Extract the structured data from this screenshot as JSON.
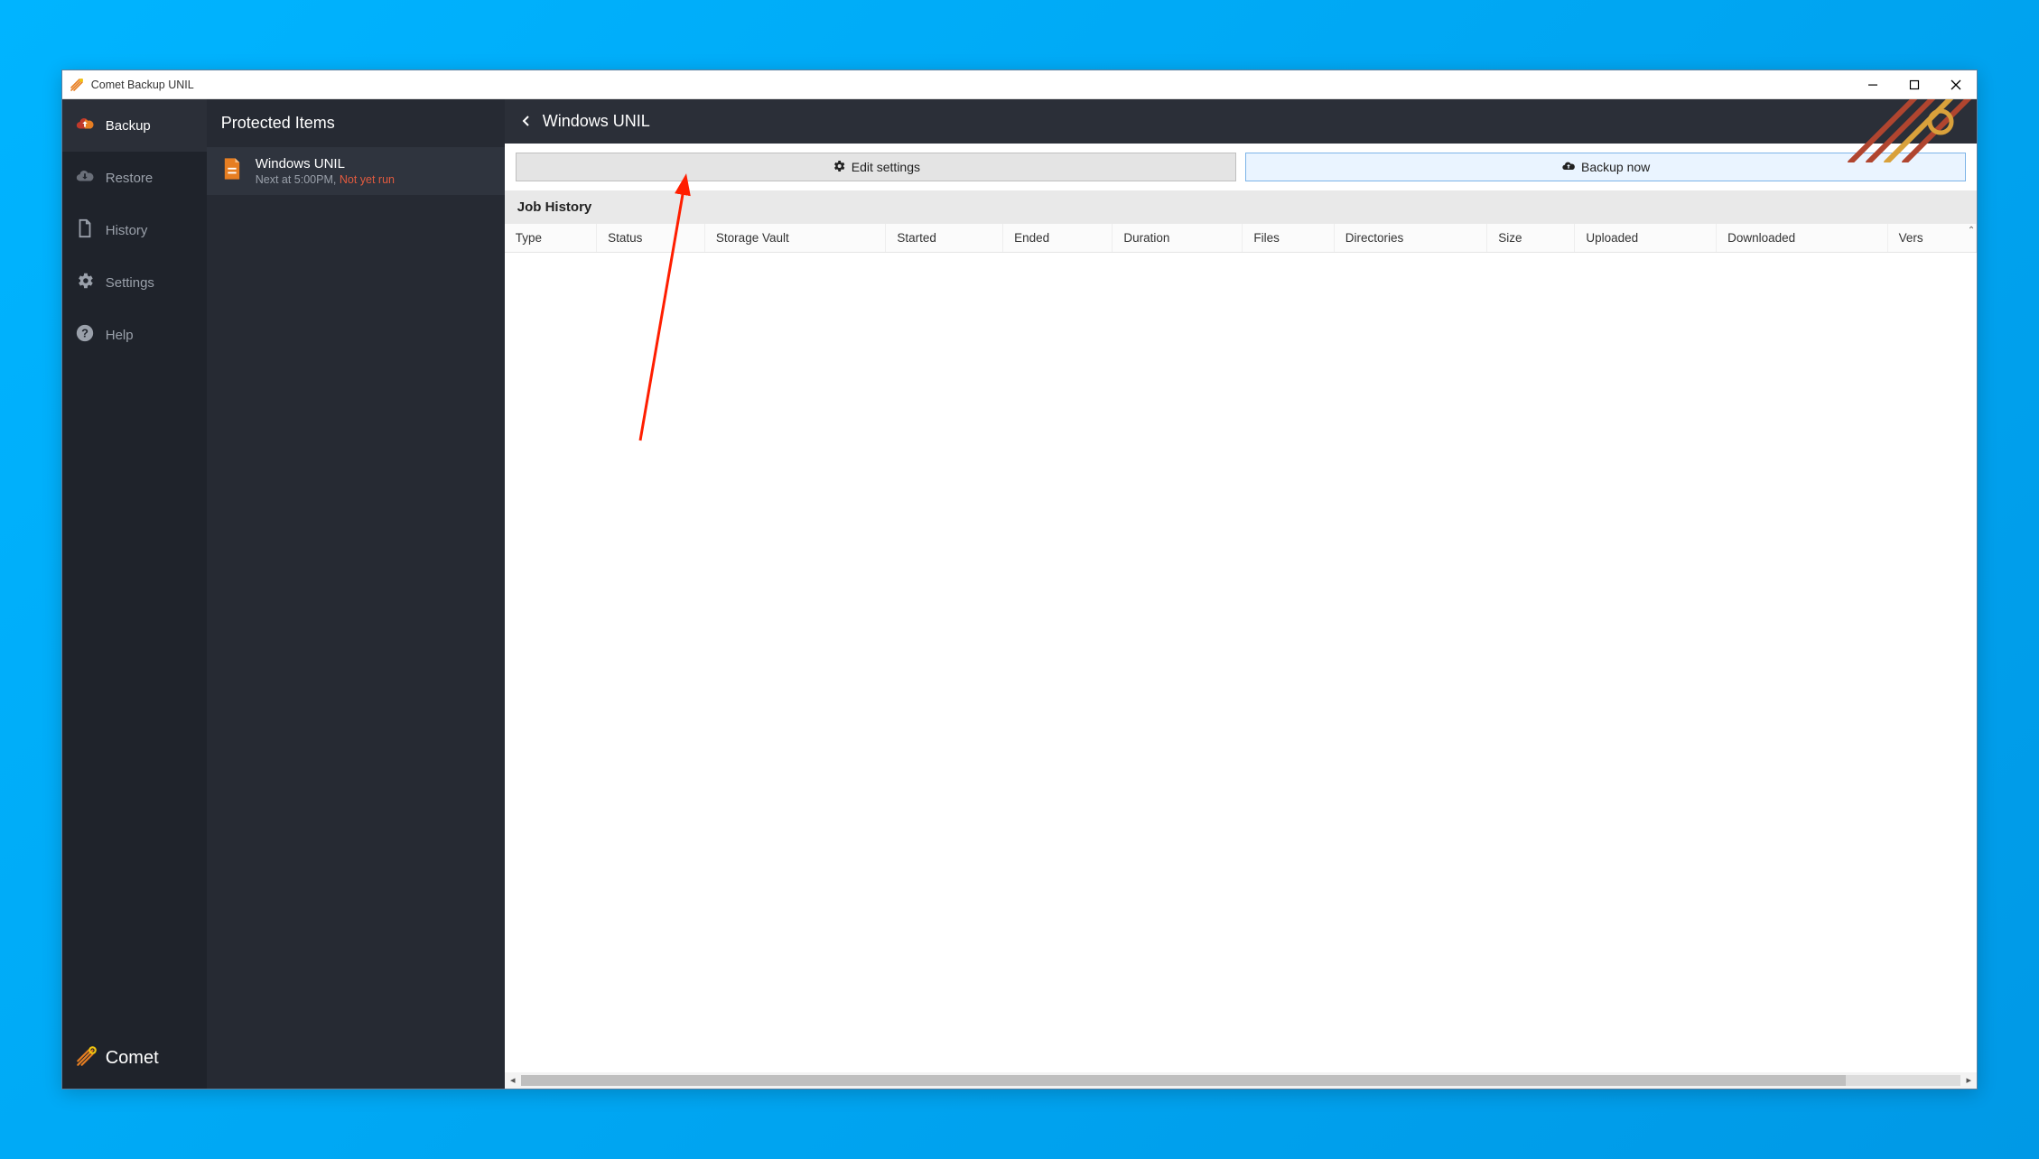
{
  "window": {
    "title": "Comet Backup UNIL"
  },
  "sidebar": {
    "items": [
      {
        "label": "Backup"
      },
      {
        "label": "Restore"
      },
      {
        "label": "History"
      },
      {
        "label": "Settings"
      },
      {
        "label": "Help"
      }
    ],
    "footer_brand": "Comet"
  },
  "listcol": {
    "header": "Protected Items",
    "items": [
      {
        "title": "Windows UNIL",
        "schedule": "Next at 5:00PM, ",
        "status": "Not yet run"
      }
    ]
  },
  "main": {
    "breadcrumb_title": "Windows UNIL",
    "buttons": {
      "edit": "Edit settings",
      "backup": "Backup now"
    },
    "job_history_title": "Job History",
    "columns": [
      "Type",
      "Status",
      "Storage Vault",
      "Started",
      "Ended",
      "Duration",
      "Files",
      "Directories",
      "Size",
      "Uploaded",
      "Downloaded",
      "Vers"
    ]
  }
}
